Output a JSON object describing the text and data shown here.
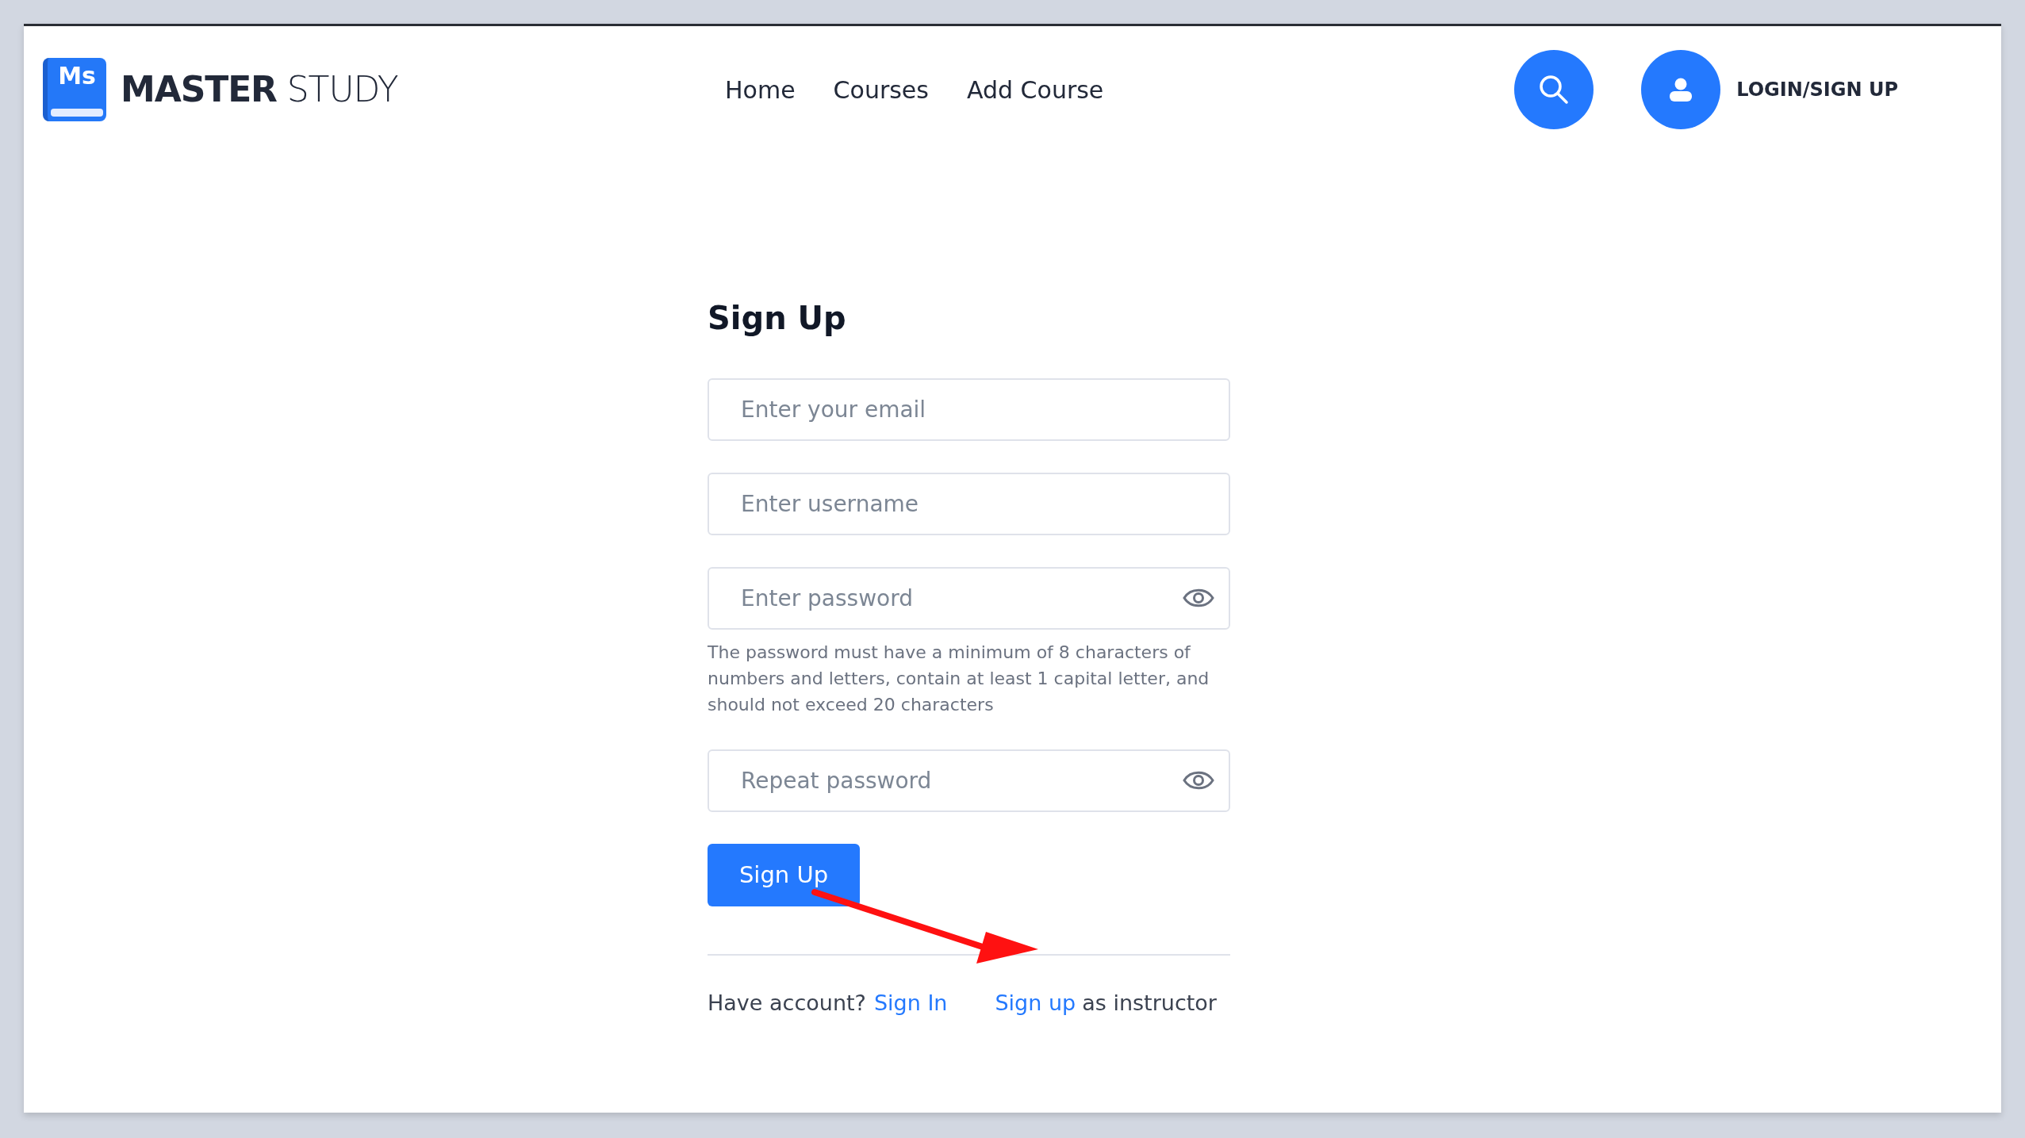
{
  "header": {
    "logo": {
      "mark": "Ms",
      "name_bold": "MASTER",
      "name_light": "STUDY"
    },
    "nav": [
      "Home",
      "Courses",
      "Add Course"
    ],
    "login": "LOGIN/SIGN UP"
  },
  "form": {
    "title": "Sign Up",
    "fields": [
      {
        "placeholder": "Enter your email",
        "kind": "text"
      },
      {
        "placeholder": "Enter username",
        "kind": "text"
      },
      {
        "placeholder": "Enter password",
        "kind": "password",
        "hint": "The password must have a minimum of 8 characters of numbers and letters, contain at least 1 capital letter, and should not exceed 20 characters"
      },
      {
        "placeholder": "Repeat password",
        "kind": "password"
      }
    ],
    "submit": "Sign Up",
    "footer": {
      "prompt": "Have account?",
      "sign_in": "Sign In",
      "instructor_link": "Sign up",
      "instructor_text": "as instructor"
    }
  }
}
